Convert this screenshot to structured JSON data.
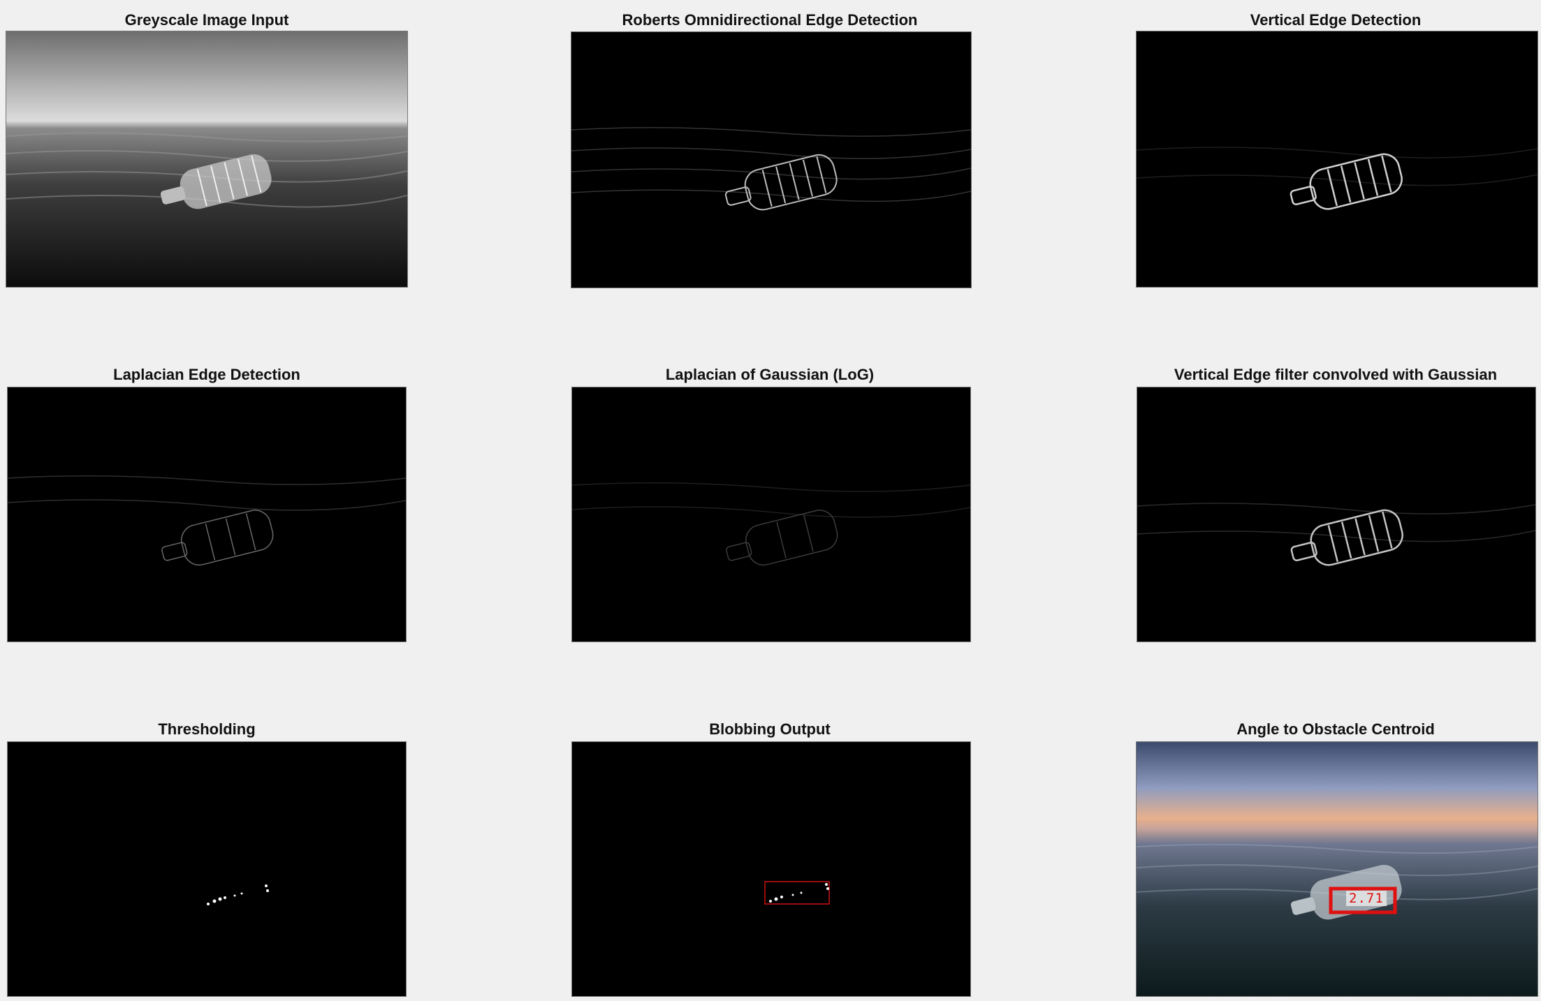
{
  "panels": [
    {
      "title": "Greyscale Image Input"
    },
    {
      "title": "Roberts Omnidirectional Edge Detection"
    },
    {
      "title": "Vertical Edge Detection"
    },
    {
      "title": "Laplacian Edge Detection"
    },
    {
      "title": "Laplacian of Gaussian (LoG)"
    },
    {
      "title": "Vertical Edge filter convolved with Gaussian"
    },
    {
      "title": "Thresholding"
    },
    {
      "title": "Blobbing Output"
    },
    {
      "title": "Angle to Obstacle Centroid"
    }
  ],
  "annotation": {
    "angle_value": "2.71",
    "box_color": "#e01010"
  },
  "colors": {
    "background": "#f0f0f0",
    "image_bg": "#000000"
  }
}
